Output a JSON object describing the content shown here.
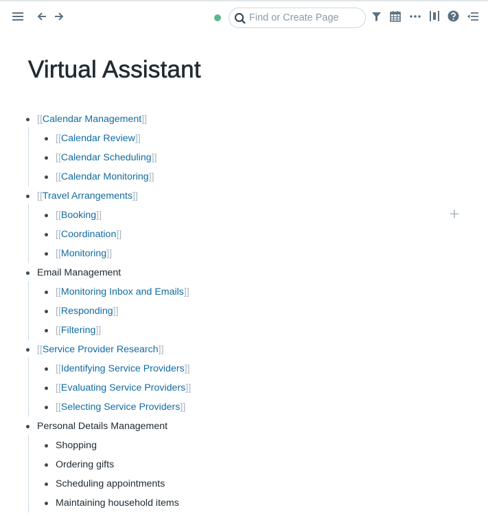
{
  "topbar": {
    "menu_icon": "hamburger-menu-icon",
    "back_icon": "arrow-left-icon",
    "forward_icon": "arrow-right-icon",
    "sync_status_color": "#5bb78c",
    "search": {
      "placeholder": "Find or Create Page",
      "value": "",
      "icon": "search-icon"
    },
    "actions": [
      {
        "name": "filter-icon"
      },
      {
        "name": "calendar-icon"
      },
      {
        "name": "more-icon"
      },
      {
        "name": "sidebar-toggle-icon"
      },
      {
        "name": "help-icon"
      },
      {
        "name": "right-sidebar-icon"
      }
    ]
  },
  "page": {
    "title": "Virtual Assistant"
  },
  "outline": [
    {
      "text": "Calendar Management",
      "is_link": true,
      "children": [
        {
          "text": "Calendar Review",
          "is_link": true
        },
        {
          "text": "Calendar Scheduling",
          "is_link": true
        },
        {
          "text": "Calendar Monitoring",
          "is_link": true
        }
      ]
    },
    {
      "text": "Travel Arrangements",
      "is_link": true,
      "children": [
        {
          "text": "Booking",
          "is_link": true
        },
        {
          "text": "Coordination",
          "is_link": true
        },
        {
          "text": "Monitoring",
          "is_link": true
        }
      ]
    },
    {
      "text": "Email Management",
      "is_link": false,
      "children": [
        {
          "text": "Monitoring Inbox and Emails",
          "is_link": true
        },
        {
          "text": "Responding",
          "is_link": true
        },
        {
          "text": "Filtering",
          "is_link": true
        }
      ]
    },
    {
      "text": "Service Provider Research",
      "is_link": true,
      "children": [
        {
          "text": "Identifying Service Providers",
          "is_link": true
        },
        {
          "text": "Evaluating Service Providers",
          "is_link": true
        },
        {
          "text": "Selecting Service Providers",
          "is_link": true
        }
      ]
    },
    {
      "text": "Personal Details Management",
      "is_link": false,
      "children": [
        {
          "text": "Shopping",
          "is_link": false
        },
        {
          "text": "Ordering gifts",
          "is_link": false
        },
        {
          "text": "Scheduling appointments",
          "is_link": false
        },
        {
          "text": "Maintaining household items",
          "is_link": false
        }
      ]
    }
  ],
  "brackets": {
    "open": "[[",
    "close": "]]"
  },
  "add_block_icon": "plus-icon"
}
